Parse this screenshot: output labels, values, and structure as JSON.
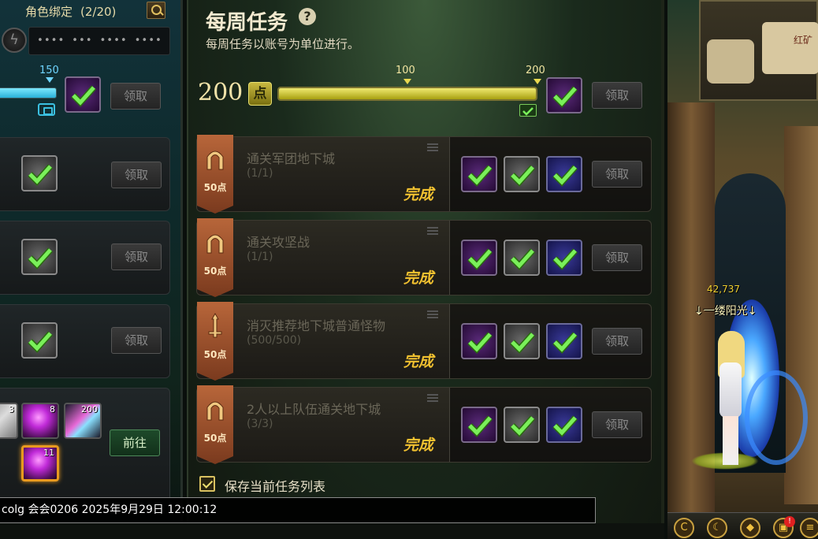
{
  "left_panel": {
    "title": "角色绑定",
    "count": "(2/20)",
    "code_value": "•••• ••• •••• ••••",
    "progress": {
      "marker_label": "150",
      "fill_fraction": 1.0,
      "claim_label": "领取"
    },
    "cards": [
      {
        "claim_label": "领取"
      },
      {
        "claim_label": "领取"
      },
      {
        "claim_label": "领取"
      }
    ],
    "items": [
      {
        "count": "3",
        "icon": "paper-item-icon"
      },
      {
        "count": "8",
        "icon": "purple-orb-icon"
      },
      {
        "count": "200",
        "icon": "crystal-item-icon"
      },
      {
        "count": "11",
        "icon": "purple-orb-icon",
        "selected": true
      }
    ],
    "goto_label": "前往"
  },
  "weekly": {
    "title": "每周任务",
    "help_symbol": "?",
    "subtitle": "每周任务以账号为单位进行。",
    "points": "200",
    "points_unit": "点",
    "progress_fraction": 1.0,
    "ticks": [
      {
        "label": "100",
        "value": 100
      },
      {
        "label": "200",
        "value": 200
      }
    ],
    "max_value": 200,
    "claim_label": "领取",
    "tasks": [
      {
        "name": "通关军团地下城",
        "progress": "(1/1)",
        "points": "50点",
        "status": "完成",
        "claim_label": "领取",
        "emblem": "arch-emblem-icon"
      },
      {
        "name": "通关攻坚战",
        "progress": "(1/1)",
        "points": "50点",
        "status": "完成",
        "claim_label": "领取",
        "emblem": "arch-emblem-icon"
      },
      {
        "name": "消灭推荐地下城普通怪物",
        "progress": "(500/500)",
        "points": "50点",
        "status": "完成",
        "claim_label": "领取",
        "emblem": "sword-emblem-icon"
      },
      {
        "name": "2人以上队伍通关地下城",
        "progress": "(3/3)",
        "points": "50点",
        "status": "完成",
        "claim_label": "领取",
        "emblem": "arch-emblem-icon"
      }
    ],
    "save_label": "保存当前任务列表",
    "save_checked": true
  },
  "scene": {
    "map_label": "红矿",
    "character_power": "42,737",
    "character_name": "↓一缕阳光↓"
  },
  "chat": {
    "text": "colg 会会0206 2025年9月29日 12:00:12"
  },
  "colors": {
    "accent_gold": "#f0c030",
    "check_green": "#5ad83a",
    "progress_yellow": "#e8e050",
    "progress_cyan": "#6fd4ff"
  }
}
